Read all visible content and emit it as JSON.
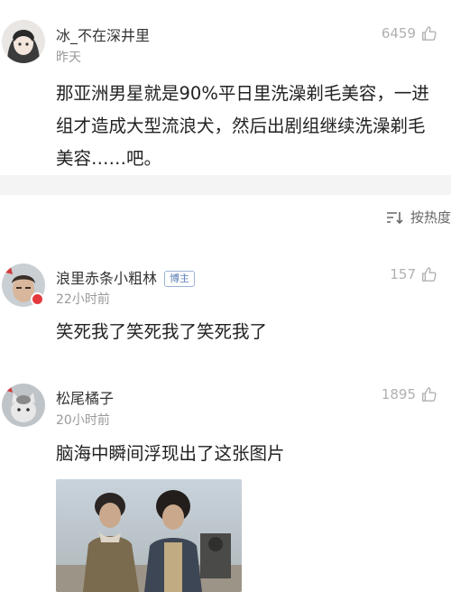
{
  "comments": [
    {
      "username": "冰_不在深井里",
      "time": "昨天",
      "likes": "6459",
      "text": "那亚洲男星就是90%平日里洗澡剃毛美容，一进组才造成大型流浪犬，然后出剧组继续洗澡剃毛美容……吧。",
      "avatar_icon": "anime-avatar"
    },
    {
      "username": "浪里赤条小粗林",
      "badge": "博主",
      "time": "22小时前",
      "likes": "157",
      "text": "笑死我了笑死我了笑死我了",
      "avatar_icon": "man-avatar"
    },
    {
      "username": "松尾橘子",
      "time": "20小时前",
      "likes": "1895",
      "text": "脑海中瞬间浮现出了这张图片",
      "avatar_icon": "cat-avatar"
    }
  ],
  "sort": {
    "label": "按热度",
    "icon": "sort-icon"
  },
  "colors": {
    "meta_gray": "#9a9a9a",
    "badge_blue": "#5b7fb6",
    "divider": "#f4f4f4"
  }
}
